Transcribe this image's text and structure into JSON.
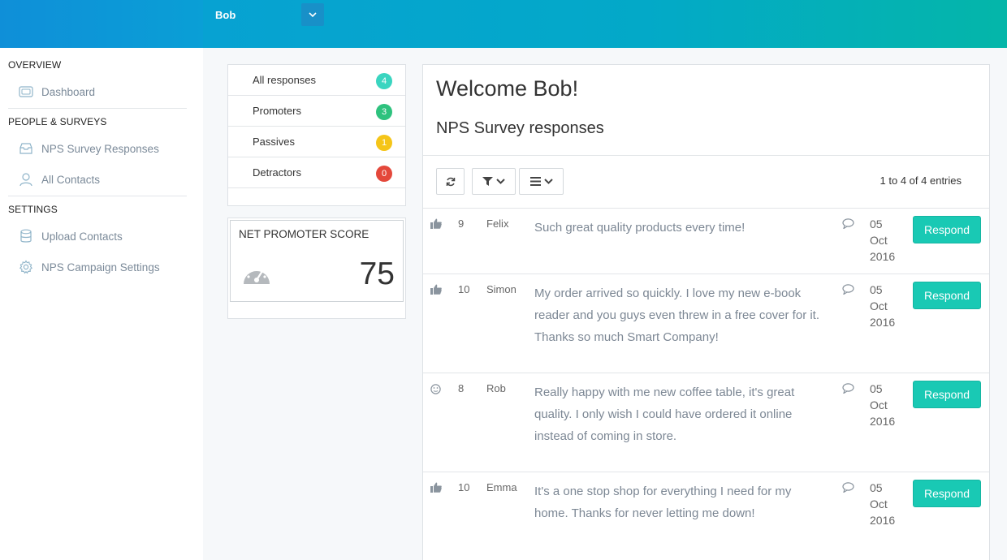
{
  "header": {
    "user_name": "Bob",
    "toggle_icon": "chevron-down-icon"
  },
  "sidebar": {
    "sections": [
      {
        "title": "OVERVIEW",
        "items": [
          {
            "label": "Dashboard",
            "icon": "dashboard-icon"
          }
        ]
      },
      {
        "title": "PEOPLE & SURVEYS",
        "items": [
          {
            "label": "NPS Survey Responses",
            "icon": "inbox-icon"
          },
          {
            "label": "All Contacts",
            "icon": "user-icon"
          }
        ]
      },
      {
        "title": "SETTINGS",
        "items": [
          {
            "label": "Upload Contacts",
            "icon": "database-icon"
          },
          {
            "label": "NPS Campaign Settings",
            "icon": "gear-icon"
          }
        ]
      }
    ]
  },
  "filters": [
    {
      "label": "All responses",
      "count": "4",
      "color": "#3ad5c0"
    },
    {
      "label": "Promoters",
      "count": "3",
      "color": "#2ec27e"
    },
    {
      "label": "Passives",
      "count": "1",
      "color": "#f5c518"
    },
    {
      "label": "Detractors",
      "count": "0",
      "color": "#e4483b"
    }
  ],
  "nps": {
    "title": "NET PROMOTER SCORE",
    "score": "75",
    "icon": "gauge-icon"
  },
  "main": {
    "welcome": "Welcome Bob!",
    "subtitle": "NPS Survey responses",
    "toolbar": {
      "refresh_icon": "refresh-icon",
      "filter_icon": "filter-icon",
      "columns_icon": "list-icon"
    },
    "entries_text": "1 to 4 of 4 entries",
    "responses": [
      {
        "type": "promoter",
        "icon": "thumbs-up-icon",
        "score": "9",
        "name": "Felix",
        "text": "Such great quality products every time!",
        "date": [
          "05",
          "Oct",
          "2016"
        ],
        "button": "Respond"
      },
      {
        "type": "promoter",
        "icon": "thumbs-up-icon",
        "score": "10",
        "name": "Simon",
        "text": "My order arrived so quickly. I love my new e-book reader and you guys even threw in a free cover for it. Thanks so much Smart Company!",
        "date": [
          "05",
          "Oct",
          "2016"
        ],
        "button": "Respond"
      },
      {
        "type": "passive",
        "icon": "neutral-face-icon",
        "score": "8",
        "name": "Rob",
        "text": "Really happy with me new coffee table, it's great quality. I only wish I could have ordered it online instead of coming in store.",
        "date": [
          "05",
          "Oct",
          "2016"
        ],
        "button": "Respond"
      },
      {
        "type": "promoter",
        "icon": "thumbs-up-icon",
        "score": "10",
        "name": "Emma",
        "text": "It's a one stop shop for everything I need for my home. Thanks for never letting me down!",
        "date": [
          "05",
          "Oct",
          "2016"
        ],
        "button": "Respond"
      }
    ]
  },
  "colors": {
    "accent": "#19c9b4",
    "header_start": "#0f8fd8",
    "header_end": "#04b6a9"
  }
}
